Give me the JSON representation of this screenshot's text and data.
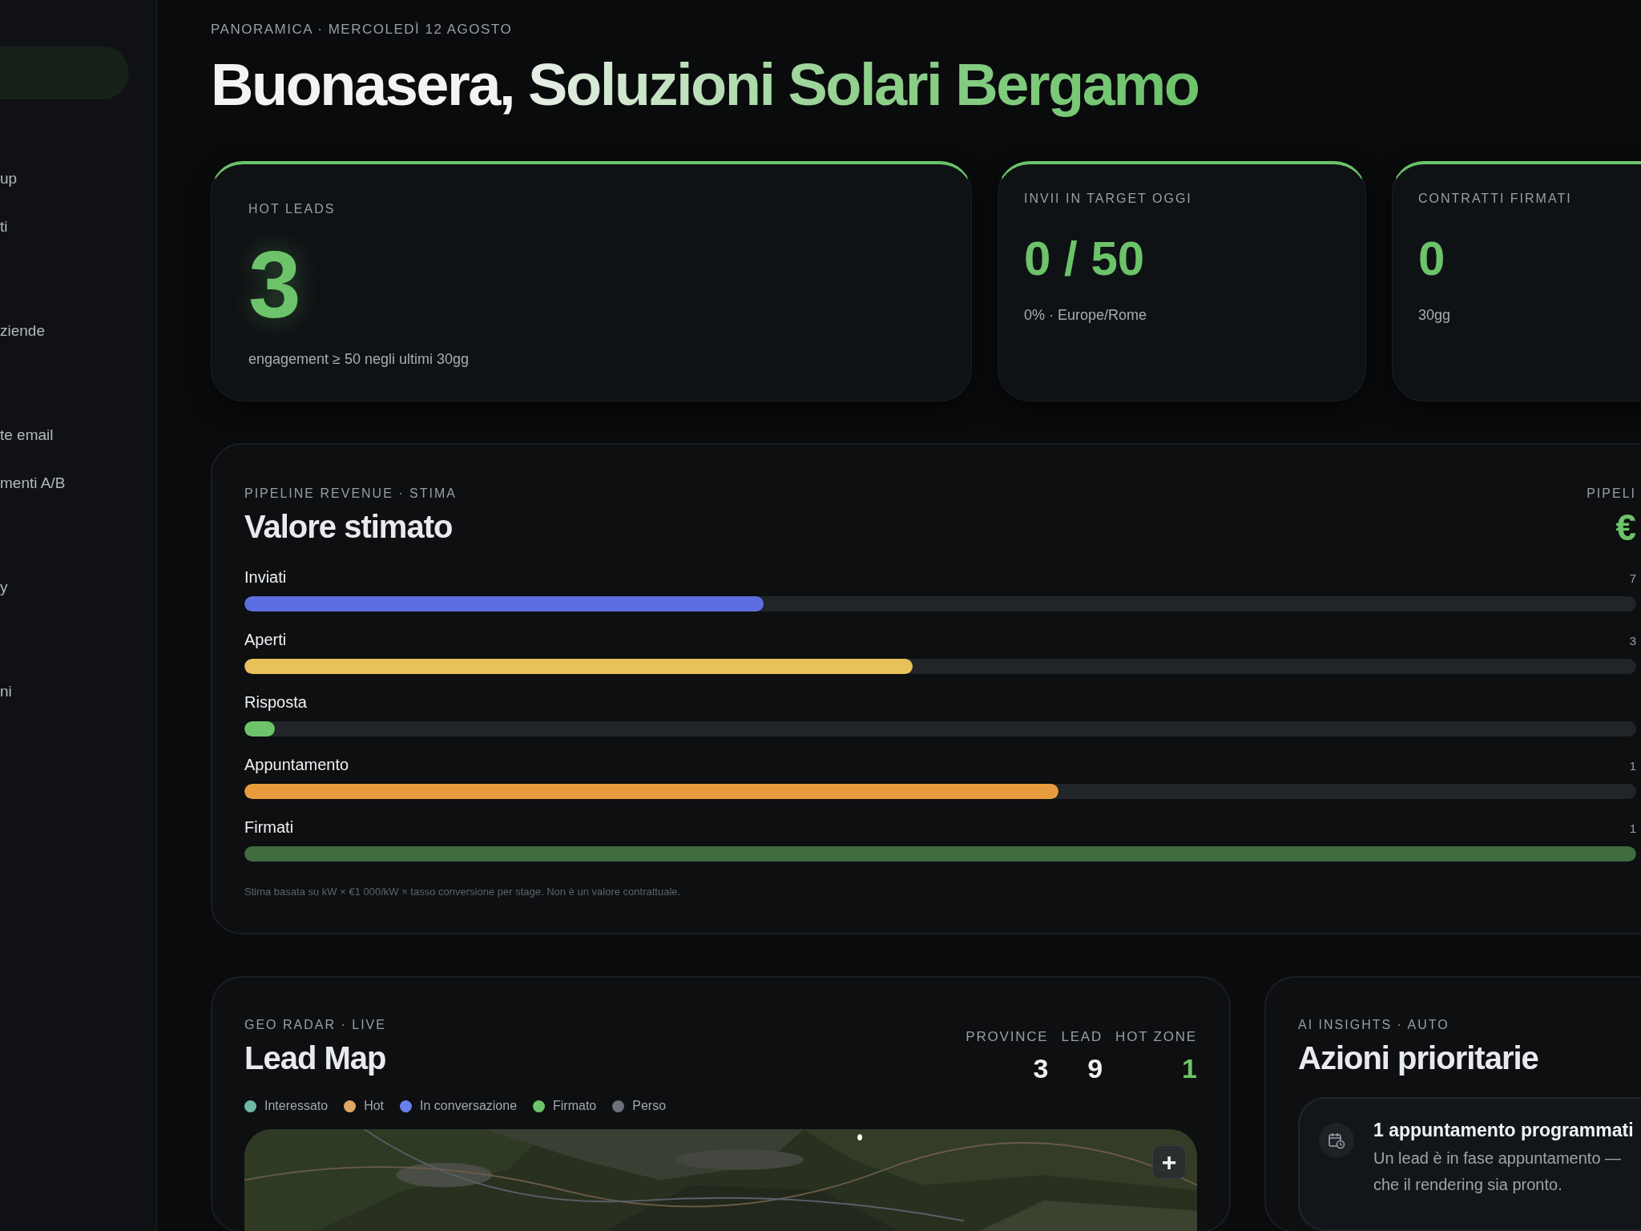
{
  "sidebar": {
    "groups": [
      {
        "items": [
          "up",
          "ti"
        ]
      },
      {
        "items": [
          "ziende"
        ]
      },
      {
        "items": [
          "te email",
          "menti A/B"
        ]
      },
      {
        "items": [
          "y"
        ]
      },
      {
        "items": [
          "ni"
        ]
      }
    ]
  },
  "header": {
    "eyebrow": "PANORAMICA · MERCOLEDÌ 12 AGOSTO",
    "greeting": "Buonasera,",
    "name": "Soluzioni Solari Bergamo"
  },
  "kpis": [
    {
      "label": "HOT LEADS",
      "value": "3",
      "note": "engagement ≥ 50 negli ultimi 30gg",
      "kind": "hero"
    },
    {
      "label": "INVII IN TARGET OGGI",
      "value": "0 / 50",
      "note": "0% · Europe/Rome",
      "kind": "plain"
    },
    {
      "label": "CONTRATTI FIRMATI",
      "value": "0",
      "note": "30gg",
      "kind": "plain"
    }
  ],
  "pipeline": {
    "eyebrow": "PIPELINE REVENUE · STIMA",
    "title": "Valore stimato",
    "total_label": "PIPELI",
    "total_value": "€",
    "stages": [
      {
        "name": "Inviati",
        "count": "7",
        "level": 0.373,
        "color": "#5c6fe0"
      },
      {
        "name": "Aperti",
        "count": "3",
        "level": 0.48,
        "color": "#e8c15a"
      },
      {
        "name": "Risposta",
        "level": 0.022,
        "color": "#6cc36a"
      },
      {
        "name": "Appuntamento",
        "count": "1",
        "level": 0.585,
        "color": "#e89b3c"
      },
      {
        "name": "Firmati",
        "count": "1",
        "level": 1.0,
        "color": "#3f6b3f"
      }
    ],
    "footnote": "Stima basata su kW × €1 000/kW × tasso conversione per stage. Non è un valore contrattuale."
  },
  "map": {
    "eyebrow": "GEO RADAR · LIVE",
    "title": "Lead Map",
    "stats": [
      {
        "label": "PROVINCE",
        "value": "3",
        "highlight": false
      },
      {
        "label": "LEAD",
        "value": "9",
        "highlight": false
      },
      {
        "label": "HOT ZONE",
        "value": "1",
        "highlight": true
      }
    ],
    "legend": [
      {
        "label": "Interessato",
        "color": "#6fb8a8"
      },
      {
        "label": "Hot",
        "color": "#e0a860"
      },
      {
        "label": "In conversazione",
        "color": "#6b7ef0"
      },
      {
        "label": "Firmato",
        "color": "#6cc36a"
      },
      {
        "label": "Perso",
        "color": "#6c7078"
      }
    ],
    "zoom_in": "+"
  },
  "insights": {
    "eyebrow": "AI INSIGHTS · AUTO",
    "title": "Azioni prioritarie",
    "items": [
      {
        "title": "1 appuntamento programmati",
        "lines": [
          "Un lead è in fase appuntamento —",
          "che il rendering sia pronto."
        ]
      }
    ]
  }
}
